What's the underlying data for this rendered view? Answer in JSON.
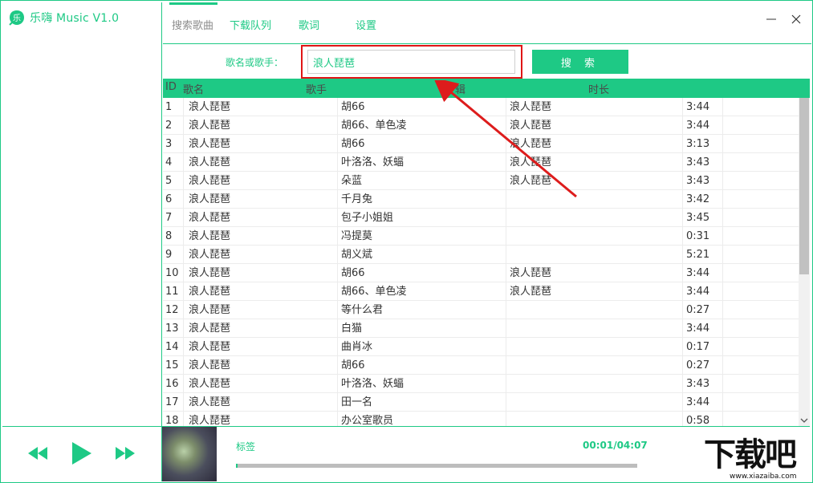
{
  "app": {
    "title": "乐嗨 Music V1.0",
    "logo_icon": "music-note-leaf-icon",
    "accent_color": "#1ec985"
  },
  "nav": {
    "tabs": [
      {
        "label": "搜索歌曲",
        "active": true
      },
      {
        "label": "下载队列",
        "active": false
      },
      {
        "label": "歌词",
        "active": false
      },
      {
        "label": "设置",
        "active": false
      }
    ]
  },
  "window_controls": {
    "minimize_icon": "minimize-icon",
    "close_icon": "close-icon"
  },
  "search": {
    "label": "歌名或歌手：",
    "value": "浪人琵琶",
    "button_label": "搜 索"
  },
  "table": {
    "columns": [
      "ID",
      "歌名",
      "歌手",
      "专辑",
      "时长"
    ],
    "rows": [
      [
        "1",
        "浪人琵琶",
        "胡66",
        "浪人琵琶",
        "3:44"
      ],
      [
        "2",
        "浪人琵琶",
        "胡66、单色凌",
        "浪人琵琶",
        "3:44"
      ],
      [
        "3",
        "浪人琵琶",
        "胡66",
        "浪人琵琶",
        "3:13"
      ],
      [
        "4",
        "浪人琵琶",
        "叶洛洛、妖蝠",
        "浪人琵琶",
        "3:43"
      ],
      [
        "5",
        "浪人琵琶",
        "朵蓝",
        "浪人琵琶",
        "3:43"
      ],
      [
        "6",
        "浪人琵琶",
        "千月兔",
        "",
        "3:42"
      ],
      [
        "7",
        "浪人琵琶",
        "包子小姐姐",
        "",
        "3:45"
      ],
      [
        "8",
        "浪人琵琶",
        "冯提莫",
        "",
        "0:31"
      ],
      [
        "9",
        "浪人琵琶",
        "胡义斌",
        "",
        "5:21"
      ],
      [
        "10",
        "浪人琵琶",
        "胡66",
        "浪人琵琶",
        "3:44"
      ],
      [
        "11",
        "浪人琵琶",
        "胡66、单色凌",
        "浪人琵琶",
        "3:44"
      ],
      [
        "12",
        "浪人琵琶",
        "等什么君",
        "",
        "0:27"
      ],
      [
        "13",
        "浪人琵琶",
        "白猫",
        "",
        "3:44"
      ],
      [
        "14",
        "浪人琵琶",
        "曲肖冰",
        "",
        "0:17"
      ],
      [
        "15",
        "浪人琵琶",
        "胡66",
        "",
        "0:27"
      ],
      [
        "16",
        "浪人琵琶",
        "叶洛洛、妖蝠",
        "",
        "3:43"
      ],
      [
        "17",
        "浪人琵琶",
        "田一名",
        "",
        "3:44"
      ],
      [
        "18",
        "浪人琵琶",
        "办公室歌员",
        "",
        "0:58"
      ]
    ]
  },
  "player": {
    "prev_icon": "rewind-icon",
    "play_icon": "play-icon",
    "next_icon": "fast-forward-icon",
    "track_label": "标签",
    "time": "00:01/04:07",
    "progress_fraction": 0.004
  },
  "watermark": {
    "big_text": "下载吧",
    "small_text": "www.xiazaiba.com"
  }
}
